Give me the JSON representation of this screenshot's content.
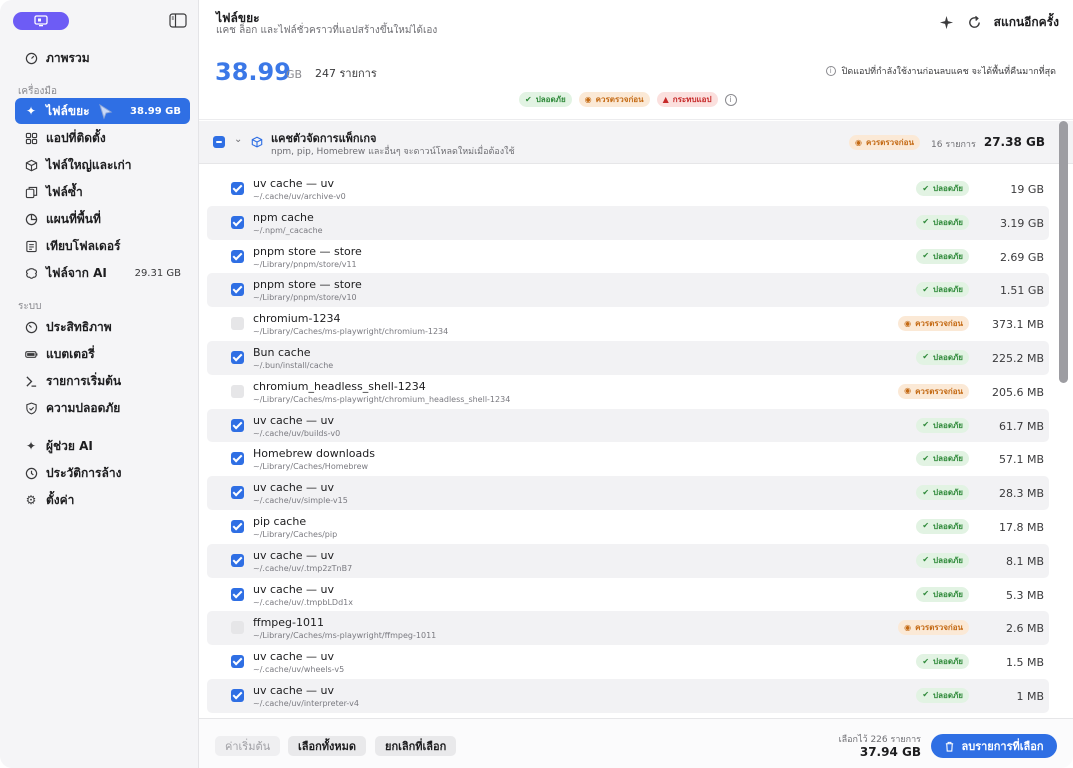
{
  "sidebar": {
    "section_tools": "เครื่องมือ",
    "section_system": "ระบบ",
    "items": [
      {
        "label": "ภาพรวม",
        "icon": "gauge-icon"
      },
      {
        "label": "ไฟล์ขยะ",
        "size": "38.99 GB",
        "icon": "sparkle-icon",
        "active": true
      },
      {
        "label": "แอปที่ติดตั้ง",
        "icon": "apps-grid-icon"
      },
      {
        "label": "ไฟล์ใหญ่และเก่า",
        "icon": "box-icon"
      },
      {
        "label": "ไฟล์ซ้ำ",
        "icon": "duplicate-icon"
      },
      {
        "label": "แผนที่พื้นที่",
        "icon": "pie-chart-icon"
      },
      {
        "label": "เทียบโฟลเดอร์",
        "icon": "compare-icon"
      },
      {
        "label": "ไฟล์จาก AI",
        "size": "29.31 GB",
        "icon": "ai-brain-icon"
      },
      {
        "label": "ประสิทธิภาพ",
        "icon": "speedometer-icon"
      },
      {
        "label": "แบตเตอรี่",
        "icon": "battery-icon"
      },
      {
        "label": "รายการเริ่มต้น",
        "icon": "startup-icon"
      },
      {
        "label": "ความปลอดภัย",
        "icon": "shield-icon"
      },
      {
        "label": "ผู้ช่วย AI",
        "icon": "sparkle-icon"
      },
      {
        "label": "ประวัติการล้าง",
        "icon": "history-icon"
      },
      {
        "label": "ตั้งค่า",
        "icon": "gear-icon"
      }
    ]
  },
  "header": {
    "title": "ไฟล์ขยะ",
    "subtitle": "แคช ล็อก และไฟล์ชั่วคราวที่แอปสร้างขึ้นใหม่ได้เอง",
    "rescan_label": "สแกนอีกครั้ง"
  },
  "summary": {
    "size": "38.99",
    "unit": "GB",
    "count": "247 รายการ",
    "hint": "ปิดแอปที่กำลังใช้งานก่อนลบแคช จะได้พื้นที่คืนมากที่สุด",
    "legend": {
      "safe": "ปลอดภัย",
      "review": "ควรตรวจก่อน",
      "danger": "กระทบแอป"
    }
  },
  "group": {
    "title": "แคชตัวจัดการแพ็กเกจ",
    "subtitle": "npm, pip, Homebrew และอื่นๆ จะดาวน์โหลดใหม่เมื่อต้องใช้",
    "badge": "ควรตรวจก่อน",
    "count": "16 รายการ",
    "size": "27.38 GB"
  },
  "items": [
    {
      "title": "uv cache — uv",
      "path": "~/.cache/uv/archive-v0",
      "status": "safe",
      "badge": "ปลอดภัย",
      "size": "19 GB",
      "checked": true
    },
    {
      "title": "npm cache",
      "path": "~/.npm/_cacache",
      "status": "safe",
      "badge": "ปลอดภัย",
      "size": "3.19 GB",
      "checked": true
    },
    {
      "title": "pnpm store — store",
      "path": "~/Library/pnpm/store/v11",
      "status": "safe",
      "badge": "ปลอดภัย",
      "size": "2.69 GB",
      "checked": true
    },
    {
      "title": "pnpm store — store",
      "path": "~/Library/pnpm/store/v10",
      "status": "safe",
      "badge": "ปลอดภัย",
      "size": "1.51 GB",
      "checked": true
    },
    {
      "title": "chromium-1234",
      "path": "~/Library/Caches/ms-playwright/chromium-1234",
      "status": "review",
      "badge": "ควรตรวจก่อน",
      "size": "373.1 MB",
      "checked": false
    },
    {
      "title": "Bun cache",
      "path": "~/.bun/install/cache",
      "status": "safe",
      "badge": "ปลอดภัย",
      "size": "225.2 MB",
      "checked": true
    },
    {
      "title": "chromium_headless_shell-1234",
      "path": "~/Library/Caches/ms-playwright/chromium_headless_shell-1234",
      "status": "review",
      "badge": "ควรตรวจก่อน",
      "size": "205.6 MB",
      "checked": false
    },
    {
      "title": "uv cache — uv",
      "path": "~/.cache/uv/builds-v0",
      "status": "safe",
      "badge": "ปลอดภัย",
      "size": "61.7 MB",
      "checked": true
    },
    {
      "title": "Homebrew downloads",
      "path": "~/Library/Caches/Homebrew",
      "status": "safe",
      "badge": "ปลอดภัย",
      "size": "57.1 MB",
      "checked": true
    },
    {
      "title": "uv cache — uv",
      "path": "~/.cache/uv/simple-v15",
      "status": "safe",
      "badge": "ปลอดภัย",
      "size": "28.3 MB",
      "checked": true
    },
    {
      "title": "pip cache",
      "path": "~/Library/Caches/pip",
      "status": "safe",
      "badge": "ปลอดภัย",
      "size": "17.8 MB",
      "checked": true
    },
    {
      "title": "uv cache — uv",
      "path": "~/.cache/uv/.tmp2zTnB7",
      "status": "safe",
      "badge": "ปลอดภัย",
      "size": "8.1 MB",
      "checked": true
    },
    {
      "title": "uv cache — uv",
      "path": "~/.cache/uv/.tmpbLDd1x",
      "status": "safe",
      "badge": "ปลอดภัย",
      "size": "5.3 MB",
      "checked": true
    },
    {
      "title": "ffmpeg-1011",
      "path": "~/Library/Caches/ms-playwright/ffmpeg-1011",
      "status": "review",
      "badge": "ควรตรวจก่อน",
      "size": "2.6 MB",
      "checked": false
    },
    {
      "title": "uv cache — uv",
      "path": "~/.cache/uv/wheels-v5",
      "status": "safe",
      "badge": "ปลอดภัย",
      "size": "1.5 MB",
      "checked": true
    },
    {
      "title": "uv cache — uv",
      "path": "~/.cache/uv/interpreter-v4",
      "status": "safe",
      "badge": "ปลอดภัย",
      "size": "1 MB",
      "checked": true
    }
  ],
  "footer": {
    "defaults_label": "ค่าเริ่มต้น",
    "select_all_label": "เลือกทั้งหมด",
    "deselect_label": "ยกเลิกที่เลือก",
    "selected_label": "เลือกไว้ 226 รายการ",
    "selected_size": "37.94 GB",
    "delete_label": "ลบรายการที่เลือก"
  },
  "colors": {
    "accent": "#2f6fe4",
    "safe": "#2f8a3a",
    "review": "#c46a14",
    "danger": "#c62828"
  }
}
